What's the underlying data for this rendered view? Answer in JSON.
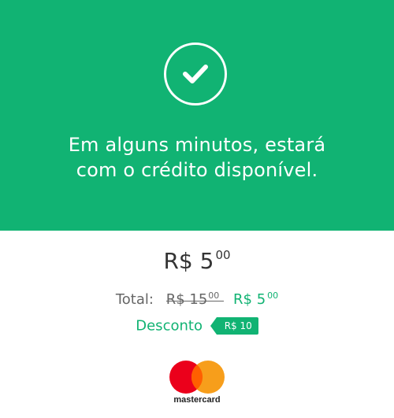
{
  "hero": {
    "bg_color": "#11b373",
    "icon": "checkmark-icon",
    "message_line1": "Em alguns minutos, estará",
    "message_line2": "com o crédito disponível."
  },
  "amount": {
    "main": "R$ 5",
    "cents": "00"
  },
  "total": {
    "label": "Total:",
    "old_main": "R$ 15",
    "old_cents": "00",
    "new_main": "R$ 5",
    "new_cents": "00"
  },
  "discount": {
    "label": "Desconto",
    "tag": "R$ 10"
  },
  "payment": {
    "brand_name": "mastercard",
    "brand_icon": "mastercard-logo-icon",
    "brand_colors": {
      "red": "#eb001b",
      "orange": "#f79e1b",
      "overlap": "#ff5f00"
    }
  }
}
